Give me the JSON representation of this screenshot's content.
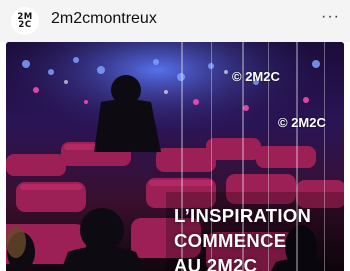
{
  "header": {
    "avatar_logo_line1": "2M",
    "avatar_logo_line2": "2C",
    "username": "2m2cmontreux",
    "more_icon": "more-horizontal-icon",
    "more_glyph": "···"
  },
  "post": {
    "watermark_1": "© 2M2C",
    "watermark_2": "© 2M2C",
    "headline_lines": [
      "L’INSPIRATION",
      "COMMENCE",
      "AU 2M2C"
    ],
    "colors": {
      "seat": "#9c1f55",
      "stage_light": "#4a7bff",
      "accent": "#ff3fa0"
    }
  }
}
